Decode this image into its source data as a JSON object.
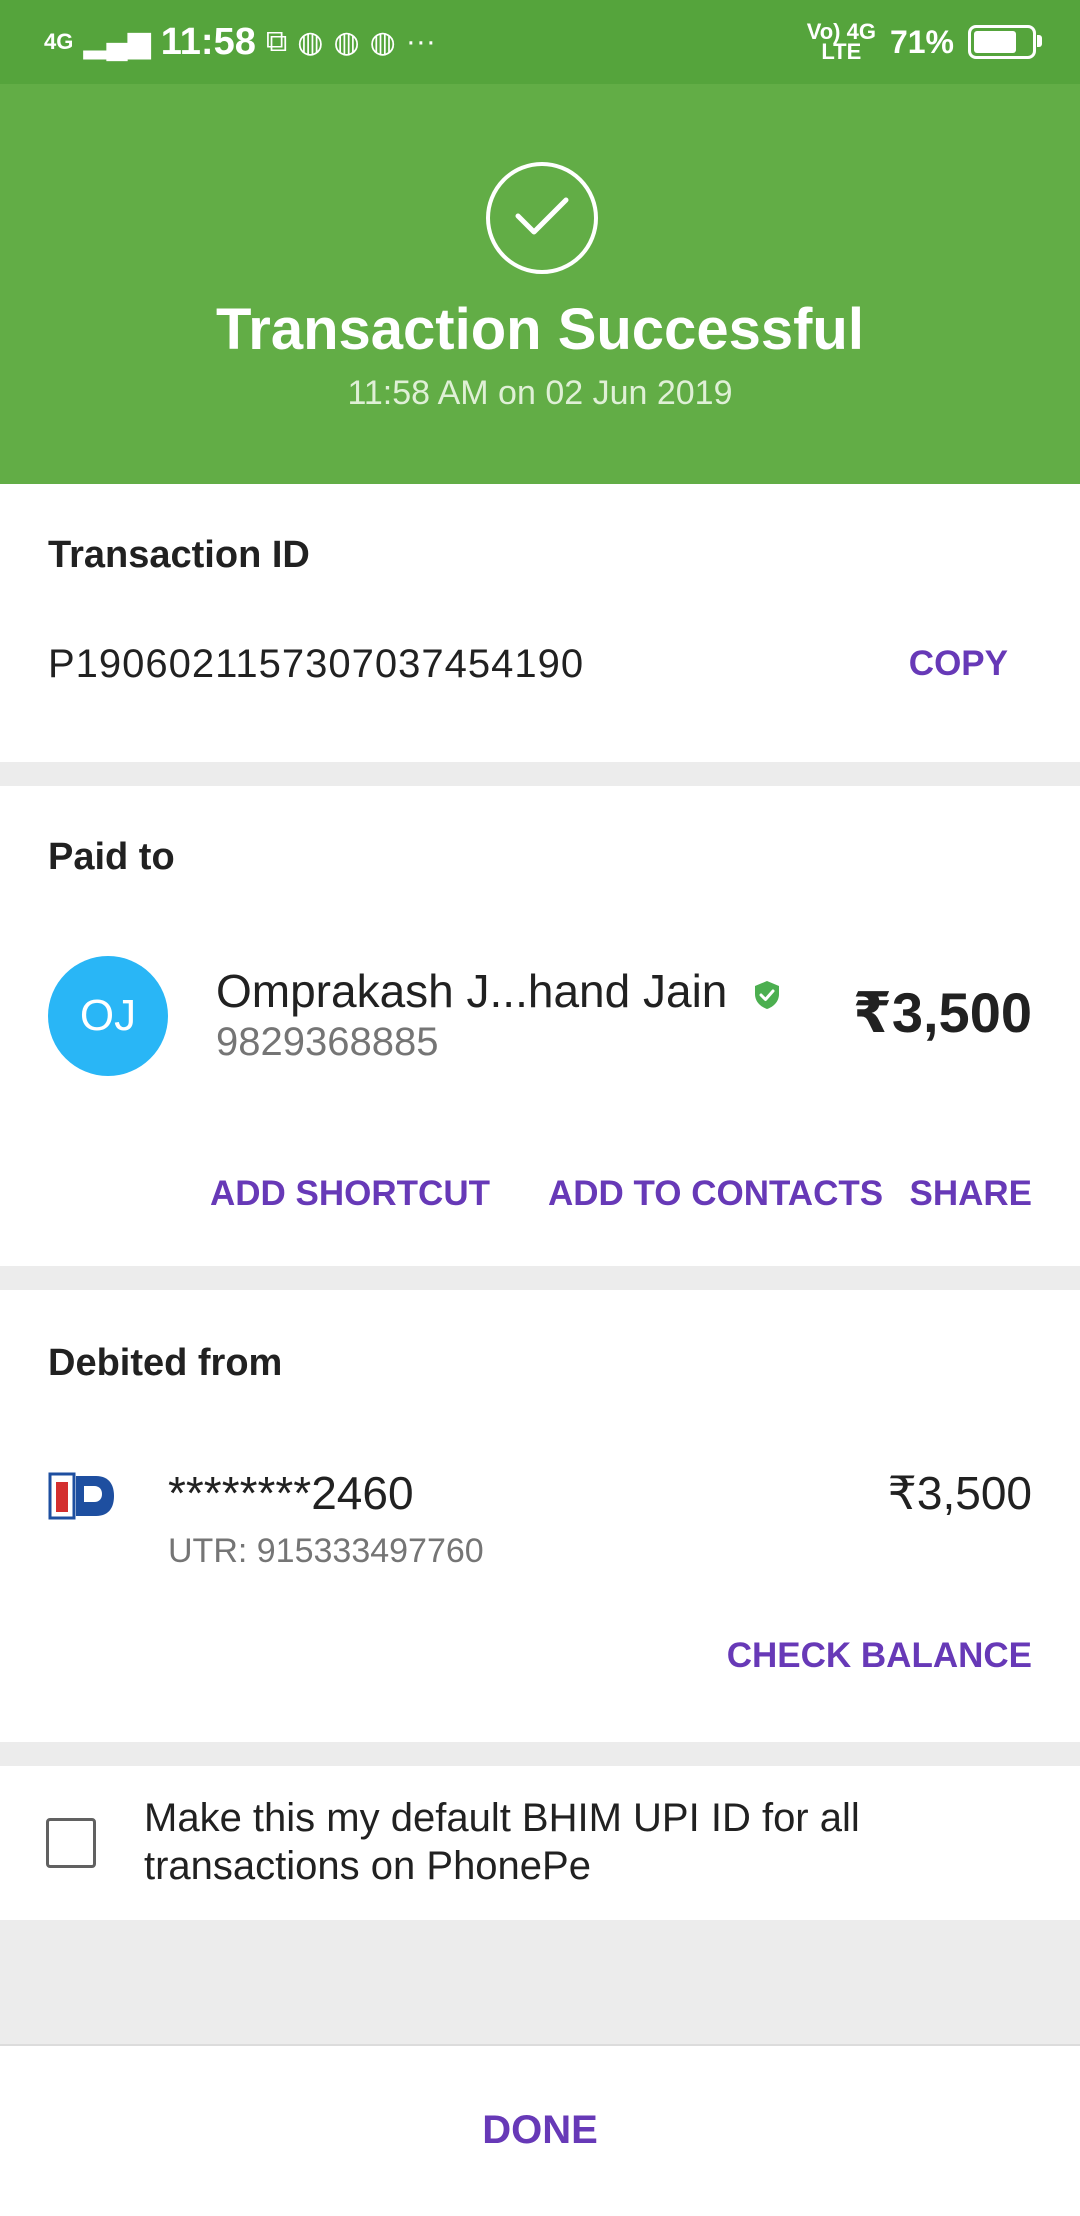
{
  "status_bar": {
    "network_left": "4G",
    "time": "11:58",
    "network_right_top": "Vo) 4G",
    "network_right_bottom": "LTE",
    "battery": "71%",
    "battery_level": 0.71,
    "overflow": "···"
  },
  "header": {
    "title": "Transaction Successful",
    "subtitle": "11:58 AM on 02 Jun 2019",
    "bg_color": "#62ad46"
  },
  "transaction": {
    "label": "Transaction ID",
    "id": "P1906021157307037454190",
    "copy_label": "COPY"
  },
  "paid_to": {
    "label": "Paid to",
    "avatar_initials": "OJ",
    "name": "Omprakash J...hand Jain",
    "phone": "9829368885",
    "amount": "₹3,500",
    "actions": {
      "add_shortcut": "ADD SHORTCUT",
      "add_to_contacts": "ADD TO CONTACTS",
      "share": "SHARE"
    }
  },
  "debited_from": {
    "label": "Debited from",
    "account": "********2460",
    "utr": "UTR: 915333497760",
    "amount": "₹3,500",
    "check_balance": "CHECK BALANCE"
  },
  "default_option": {
    "text": "Make this my default BHIM UPI ID for all transactions on PhonePe",
    "checked": false
  },
  "footer": {
    "done_label": "DONE"
  },
  "colors": {
    "accent": "#6739b7",
    "success_green": "#62ad46",
    "avatar_blue": "#29b6f6"
  }
}
